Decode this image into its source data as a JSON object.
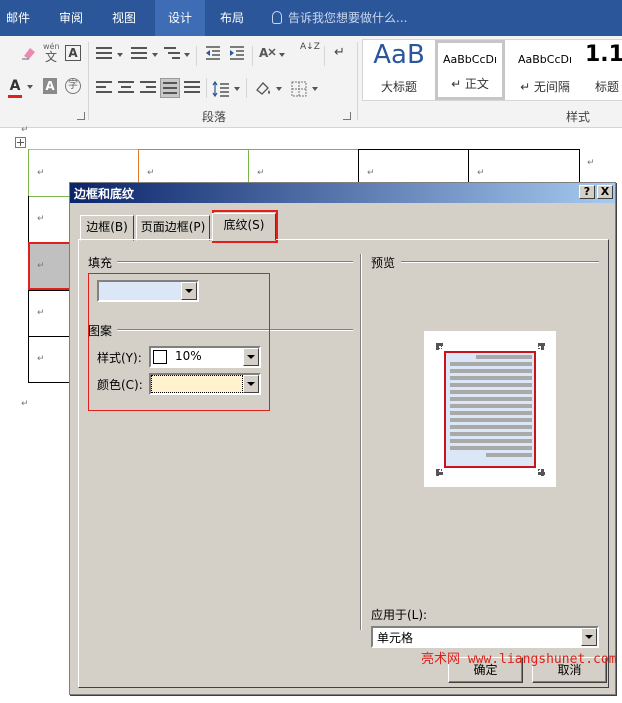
{
  "ribbon_tabs": [
    "邮件",
    "审阅",
    "视图",
    "设计",
    "布局"
  ],
  "active_ribbon_tab": "设计",
  "tell_me_placeholder": "告诉我您想要做什么...",
  "ribbon": {
    "paragraph_group_label": "段落",
    "styles_group_label": "样式",
    "styles": [
      {
        "sample": "AaB",
        "name": "大标题"
      },
      {
        "sample": "AaBbCcDı",
        "name": "↵ 正文"
      },
      {
        "sample": "AaBbCcDı",
        "name": "↵ 无间隔"
      },
      {
        "sample": "1.1",
        "name": "标题"
      }
    ],
    "font_color_letter": "A",
    "phonetic_top": "wén",
    "phonetic_char": "文",
    "boxed_A": "A",
    "shade_A": "A",
    "circle_char": "字",
    "aa_text": "A",
    "sort_text": "A↓Z"
  },
  "paragraph_mark": "↵",
  "dialog": {
    "title": "边框和底纹",
    "help_btn": "?",
    "close_btn": "X",
    "tabs": [
      "边框(B)",
      "页面边框(P)",
      "底纹(S)"
    ],
    "active_tab": "底纹(S)",
    "fill_label": "填充",
    "fill_color": "#dbe7f7",
    "pattern_label": "图案",
    "style_label": "样式(Y):",
    "style_value": "10%",
    "color_label": "颜色(C):",
    "color_value": "#fff2cc",
    "preview_label": "预览",
    "apply_to_label": "应用于(L):",
    "apply_to_value": "单元格",
    "ok_label": "确定",
    "cancel_label": "取消"
  },
  "watermark": "亮术网 www.liangshunet.com",
  "colors": {
    "ribbon_blue": "#2b579a",
    "highlight_red": "#e0201c",
    "dialog_gray": "#d4d0c8",
    "title_gradient_start": "#0a246a",
    "title_gradient_end": "#a6caf0",
    "selected_cell_gray": "#c0c0c0"
  }
}
